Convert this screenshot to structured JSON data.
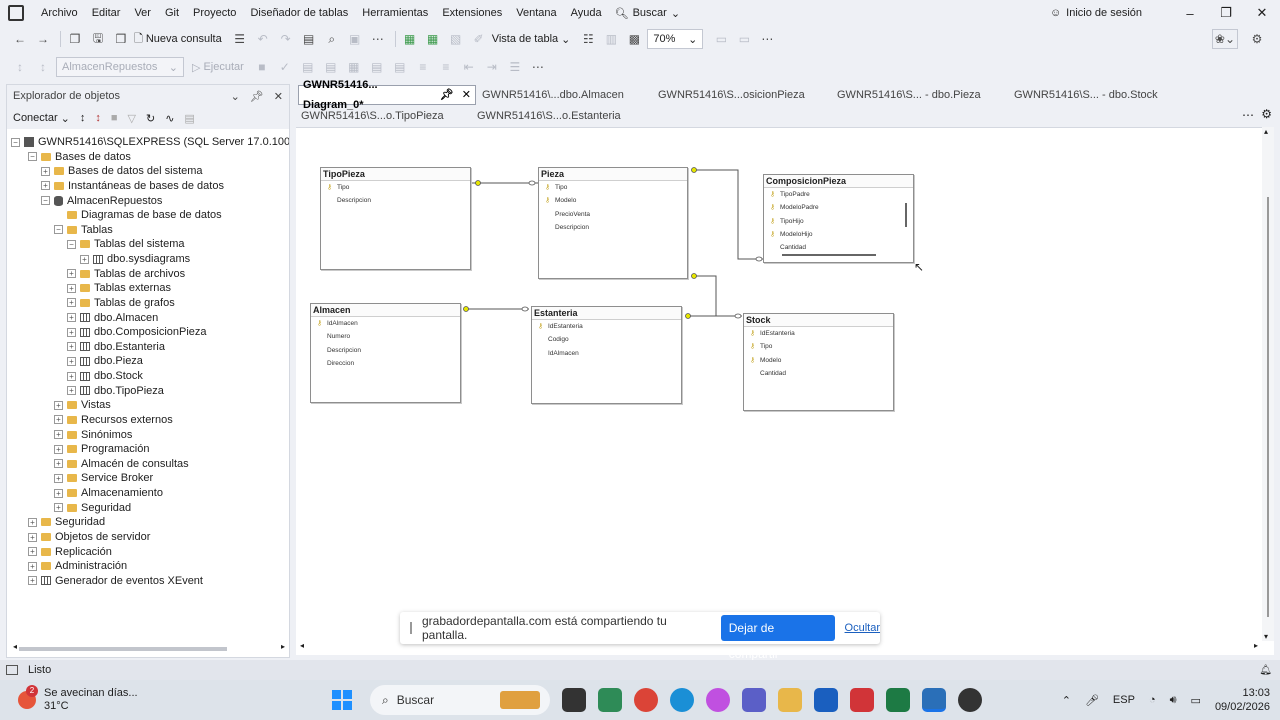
{
  "menubar": {
    "items": [
      "Archivo",
      "Editar",
      "Ver",
      "Git",
      "Proyecto",
      "Diseñador de tablas",
      "Herramientas",
      "Extensiones",
      "Ventana",
      "Ayuda"
    ],
    "search_label": "Buscar",
    "signin_label": "Inicio de sesión"
  },
  "toolbar": {
    "new_query_label": "Nueva consulta",
    "table_view_label": "Vista de tabla",
    "zoom_value": "70%",
    "database_value": "AlmacenRepuestos",
    "execute_label": "Ejecutar"
  },
  "object_explorer": {
    "title": "Explorador de objetos",
    "connect_label": "Conectar",
    "server_label": "GWNR51416\\SQLEXPRESS (SQL Server 17.0.1000 - GWNR51416)",
    "nodes": [
      {
        "label": "Bases de datos",
        "level": 1,
        "toggle": "−",
        "icon": "folder"
      },
      {
        "label": "Bases de datos del sistema",
        "level": 2,
        "toggle": "+",
        "icon": "folder"
      },
      {
        "label": "Instantáneas de bases de datos",
        "level": 2,
        "toggle": "+",
        "icon": "folder"
      },
      {
        "label": "AlmacenRepuestos",
        "level": 2,
        "toggle": "−",
        "icon": "database"
      },
      {
        "label": "Diagramas de base de datos",
        "level": 3,
        "toggle": "",
        "icon": "folder"
      },
      {
        "label": "Tablas",
        "level": 3,
        "toggle": "−",
        "icon": "folder"
      },
      {
        "label": "Tablas del sistema",
        "level": 4,
        "toggle": "−",
        "icon": "folder"
      },
      {
        "label": "dbo.sysdiagrams",
        "level": 5,
        "toggle": "+",
        "icon": "table"
      },
      {
        "label": "Tablas de archivos",
        "level": 4,
        "toggle": "+",
        "icon": "folder"
      },
      {
        "label": "Tablas externas",
        "level": 4,
        "toggle": "+",
        "icon": "folder"
      },
      {
        "label": "Tablas de grafos",
        "level": 4,
        "toggle": "+",
        "icon": "folder"
      },
      {
        "label": "dbo.Almacen",
        "level": 4,
        "toggle": "+",
        "icon": "table"
      },
      {
        "label": "dbo.ComposicionPieza",
        "level": 4,
        "toggle": "+",
        "icon": "table"
      },
      {
        "label": "dbo.Estanteria",
        "level": 4,
        "toggle": "+",
        "icon": "table"
      },
      {
        "label": "dbo.Pieza",
        "level": 4,
        "toggle": "+",
        "icon": "table"
      },
      {
        "label": "dbo.Stock",
        "level": 4,
        "toggle": "+",
        "icon": "table"
      },
      {
        "label": "dbo.TipoPieza",
        "level": 4,
        "toggle": "+",
        "icon": "table"
      },
      {
        "label": "Vistas",
        "level": 3,
        "toggle": "+",
        "icon": "folder"
      },
      {
        "label": "Recursos externos",
        "level": 3,
        "toggle": "+",
        "icon": "folder"
      },
      {
        "label": "Sinónimos",
        "level": 3,
        "toggle": "+",
        "icon": "folder"
      },
      {
        "label": "Programación",
        "level": 3,
        "toggle": "+",
        "icon": "folder"
      },
      {
        "label": "Almacén de consultas",
        "level": 3,
        "toggle": "+",
        "icon": "folder"
      },
      {
        "label": "Service Broker",
        "level": 3,
        "toggle": "+",
        "icon": "folder"
      },
      {
        "label": "Almacenamiento",
        "level": 3,
        "toggle": "+",
        "icon": "folder"
      },
      {
        "label": "Seguridad",
        "level": 3,
        "toggle": "+",
        "icon": "folder"
      },
      {
        "label": "Seguridad",
        "level": 1,
        "toggle": "+",
        "icon": "folder"
      },
      {
        "label": "Objetos de servidor",
        "level": 1,
        "toggle": "+",
        "icon": "folder"
      },
      {
        "label": "Replicación",
        "level": 1,
        "toggle": "+",
        "icon": "folder"
      },
      {
        "label": "Administración",
        "level": 1,
        "toggle": "+",
        "icon": "folder"
      },
      {
        "label": "Generador de eventos XEvent",
        "level": 1,
        "toggle": "+",
        "icon": "xevent"
      }
    ]
  },
  "tabs": {
    "active": "GWNR51416... Diagram_0*",
    "row1": [
      "GWNR51416\\...dbo.Almacen",
      "GWNR51416\\S...osicionPieza",
      "GWNR51416\\S... - dbo.Pieza",
      "GWNR51416\\S... - dbo.Stock"
    ],
    "row2": [
      "GWNR51416\\S...o.TipoPieza",
      "GWNR51416\\S...o.Estanteria"
    ]
  },
  "diagram": {
    "tables": [
      {
        "name": "TipoPieza",
        "columns": [
          {
            "name": "Tipo",
            "key": true
          },
          {
            "name": "Descripcion",
            "key": false
          }
        ]
      },
      {
        "name": "Pieza",
        "columns": [
          {
            "name": "Tipo",
            "key": true
          },
          {
            "name": "Modelo",
            "key": true
          },
          {
            "name": "PrecioVenta",
            "key": false
          },
          {
            "name": "Descripcion",
            "key": false
          }
        ]
      },
      {
        "name": "ComposicionPieza",
        "columns": [
          {
            "name": "TipoPadre",
            "key": true
          },
          {
            "name": "ModeloPadre",
            "key": true
          },
          {
            "name": "TipoHijo",
            "key": true
          },
          {
            "name": "ModeloHijo",
            "key": true
          },
          {
            "name": "Cantidad",
            "key": false
          }
        ]
      },
      {
        "name": "Almacen",
        "columns": [
          {
            "name": "IdAlmacen",
            "key": true
          },
          {
            "name": "Numero",
            "key": false
          },
          {
            "name": "Descripcion",
            "key": false
          },
          {
            "name": "Direccion",
            "key": false
          }
        ]
      },
      {
        "name": "Estanteria",
        "columns": [
          {
            "name": "IdEstanteria",
            "key": true
          },
          {
            "name": "Codigo",
            "key": false
          },
          {
            "name": "IdAlmacen",
            "key": false
          }
        ]
      },
      {
        "name": "Stock",
        "columns": [
          {
            "name": "IdEstanteria",
            "key": true
          },
          {
            "name": "Tipo",
            "key": true
          },
          {
            "name": "Modelo",
            "key": true
          },
          {
            "name": "Cantidad",
            "key": false
          }
        ]
      }
    ]
  },
  "share_banner": {
    "message": "grabadordepantalla.com está compartiendo tu pantalla.",
    "stop_label": "Dejar de compartir",
    "hide_label": "Ocultar"
  },
  "status": {
    "text": "Listo"
  },
  "taskbar": {
    "weather_text": "Se avecinan días...",
    "temperature": "31°C",
    "weather_badge": "2",
    "search_placeholder": "Buscar",
    "language": "ESP",
    "time": "13:03",
    "date": "09/02/2026"
  },
  "colors": {
    "accent": "#1a73e8",
    "key_icon": "#c7a82c",
    "relation_end": "#e6e600"
  }
}
